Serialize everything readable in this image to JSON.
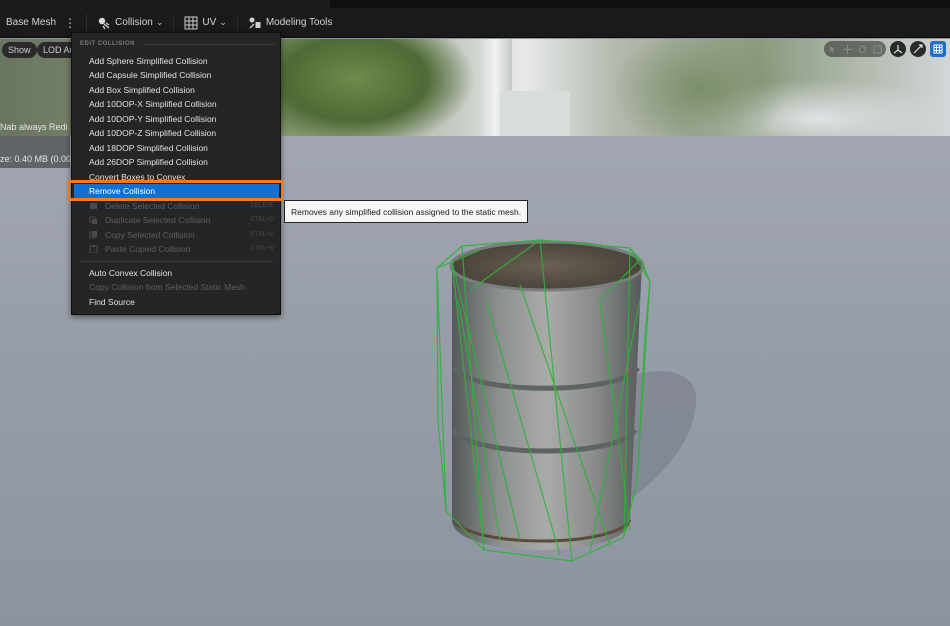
{
  "toolbar": {
    "base_mesh_label": "Base Mesh",
    "collision_label": "Collision",
    "uv_label": "UV",
    "modeling_tools_label": "Modeling Tools"
  },
  "viewport": {
    "show_label": "Show",
    "lod_label": "LOD Au",
    "overlay_text_1": "Nab always Redi",
    "overlay_text_2": "ze: 0.40 MB (0.00 M"
  },
  "menu": {
    "section_header": "EDIT COLLISION",
    "items": [
      {
        "label": "Add Sphere Simplified Collision",
        "enabled": true
      },
      {
        "label": "Add Capsule Simplified Collision",
        "enabled": true
      },
      {
        "label": "Add Box Simplified Collision",
        "enabled": true
      },
      {
        "label": "Add 10DOP-X Simplified Collision",
        "enabled": true
      },
      {
        "label": "Add 10DOP-Y Simplified Collision",
        "enabled": true
      },
      {
        "label": "Add 10DOP-Z Simplified Collision",
        "enabled": true
      },
      {
        "label": "Add 18DOP Simplified Collision",
        "enabled": true
      },
      {
        "label": "Add 26DOP Simplified Collision",
        "enabled": true
      },
      {
        "label": "Convert Boxes to Convex",
        "enabled": true
      },
      {
        "label": "Remove Collision",
        "enabled": true,
        "highlighted": true
      },
      {
        "label": "Delete Selected Collision",
        "enabled": false,
        "shortcut": "DELETE"
      },
      {
        "label": "Duplicate Selected Collision",
        "enabled": false,
        "shortcut": "CTRL+D"
      },
      {
        "label": "Copy Selected Collision",
        "enabled": false,
        "shortcut": "CTRL+C"
      },
      {
        "label": "Paste Copied Collision",
        "enabled": false,
        "shortcut": "CTRL+V"
      },
      {
        "label": "Auto Convex Collision",
        "enabled": true
      },
      {
        "label": "Copy Collision from Selected Static Mesh",
        "enabled": false
      },
      {
        "label": "Find Source",
        "enabled": true
      }
    ]
  },
  "tooltip": {
    "text": "Removes any simplified collision assigned to the static mesh."
  },
  "colors": {
    "accent": "#0f70d6",
    "highlight_outline": "#f07a1d",
    "collision_wire": "#2fb23a"
  }
}
